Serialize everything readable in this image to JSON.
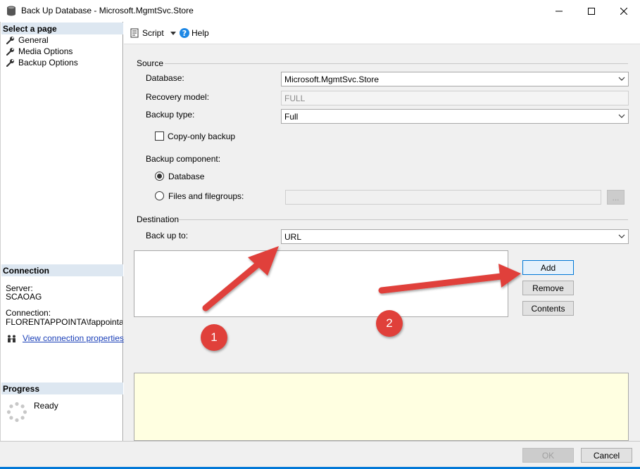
{
  "window": {
    "title": "Back Up Database - Microsoft.MgmtSvc.Store"
  },
  "left": {
    "select_page": "Select a page",
    "pages": [
      "General",
      "Media Options",
      "Backup Options"
    ],
    "connection": {
      "header": "Connection",
      "server_label": "Server:",
      "server_value": "SCAOAG",
      "connection_label": "Connection:",
      "connection_value": "FLORENTAPPOINTA\\fappointaire",
      "view_link": "View connection properties"
    },
    "progress": {
      "header": "Progress",
      "status": "Ready"
    }
  },
  "toolbar": {
    "script_label": "Script",
    "help_label": "Help"
  },
  "source": {
    "group_label": "Source",
    "database_label": "Database:",
    "database_value": "Microsoft.MgmtSvc.Store",
    "recovery_label": "Recovery model:",
    "recovery_value": "FULL",
    "backup_type_label": "Backup type:",
    "backup_type_value": "Full",
    "copy_only_label": "Copy-only backup",
    "component_label": "Backup component:",
    "component_database": "Database",
    "component_files": "Files and filegroups:",
    "browse_label": "..."
  },
  "destination": {
    "group_label": "Destination",
    "backup_to_label": "Back up to:",
    "backup_to_value": "URL",
    "add_label": "Add",
    "remove_label": "Remove",
    "contents_label": "Contents"
  },
  "footer": {
    "ok_label": "OK",
    "cancel_label": "Cancel"
  },
  "annotations": {
    "badge1": "1",
    "badge2": "2"
  },
  "colors": {
    "accent": "#0078d7",
    "annotation": "#e0403a",
    "section_header": "#dde7f1",
    "message_bg": "#ffffe1"
  }
}
